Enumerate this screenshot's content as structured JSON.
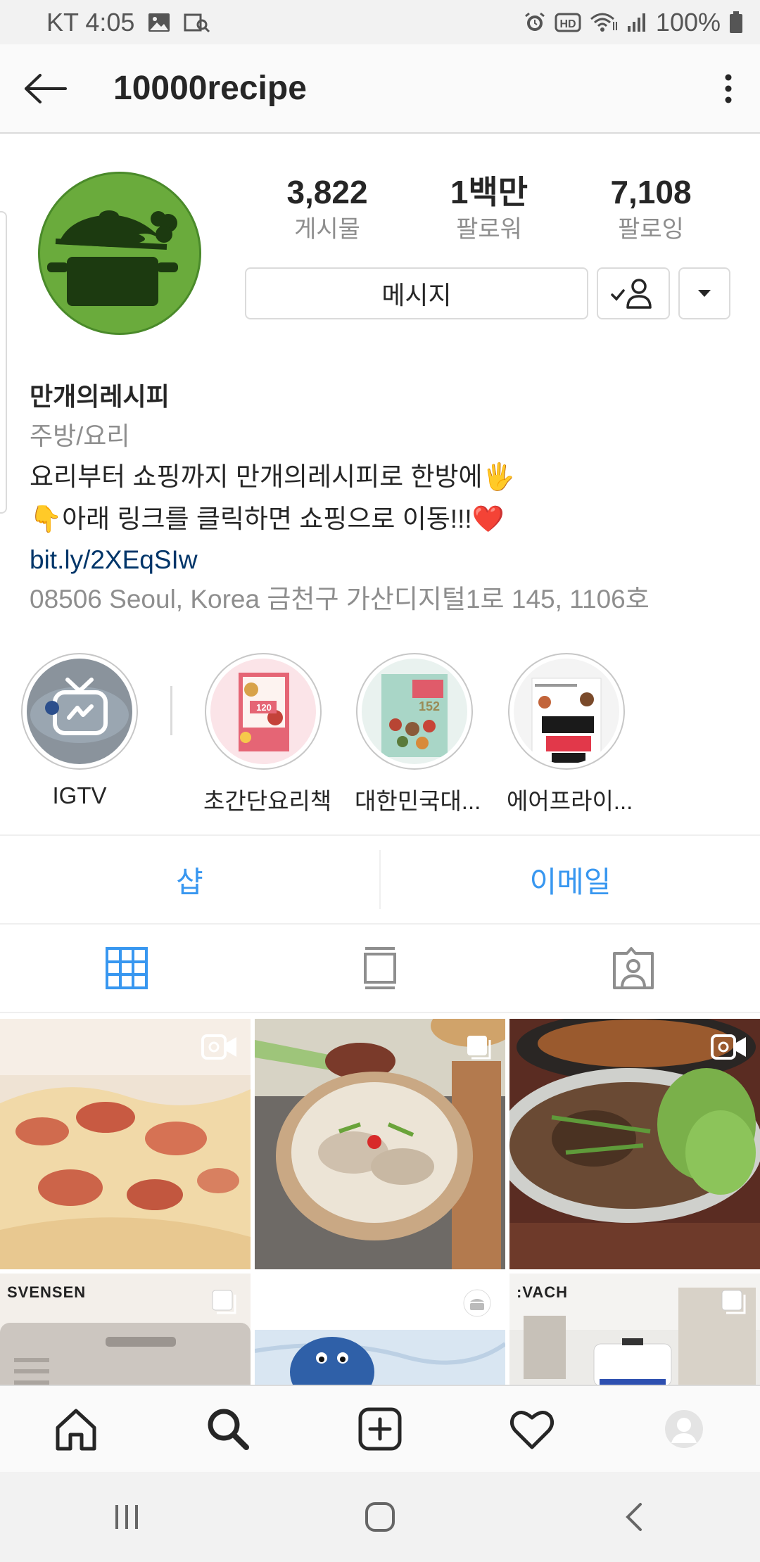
{
  "status_bar": {
    "carrier_time": "KT 4:05",
    "battery": "100%"
  },
  "header": {
    "username": "10000recipe"
  },
  "profile": {
    "stats": [
      {
        "value": "3,822",
        "label": "게시물"
      },
      {
        "value": "1백만",
        "label": "팔로워"
      },
      {
        "value": "7,108",
        "label": "팔로잉"
      }
    ],
    "message_button": "메시지",
    "name": "만개의레시피",
    "category": "주방/요리",
    "bio_lines": [
      "요리부터 쇼핑까지 만개의레시피로 한방에🖐",
      "👇아래 링크를 클릭하면 쇼핑으로 이동!!!❤️"
    ],
    "link": "bit.ly/2XEqSIw",
    "address": "08506 Seoul, Korea 금천구 가산디지털1로 145, 1106호"
  },
  "highlights": [
    {
      "label": "IGTV"
    },
    {
      "label": "초간단요리책"
    },
    {
      "label": "대한민국대..."
    },
    {
      "label": "에어프라이..."
    }
  ],
  "actions": {
    "shop": "샵",
    "email": "이메일"
  },
  "grid_brands": {
    "cell4": "SVENSEN",
    "cell6": ":VACH"
  },
  "colors": {
    "link_blue": "#3897f0",
    "bio_link": "#003569",
    "avatar_green": "#6aab3c"
  }
}
